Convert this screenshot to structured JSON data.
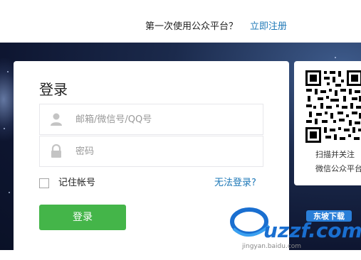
{
  "header": {
    "first_time_prompt": "第一次使用公众平台？",
    "register_link": "立即注册"
  },
  "login": {
    "title": "登录",
    "account_placeholder": "邮箱/微信号/QQ号",
    "password_placeholder": "密码",
    "remember_label": "记住帐号",
    "cant_login_link": "无法登录?",
    "login_button": "登录"
  },
  "qr": {
    "caption_line1": "扫描并关注",
    "caption_line2": "微信公众平台"
  },
  "watermark": {
    "brand": "uzzf.com",
    "tagline": "东坡下载",
    "source": "jingyan.baidu.com"
  },
  "colors": {
    "accent_green": "#44b549",
    "link_blue": "#1e78b7",
    "hero_dark": "#0e1631"
  },
  "icons": {
    "account": "user-icon",
    "password": "lock-icon"
  }
}
